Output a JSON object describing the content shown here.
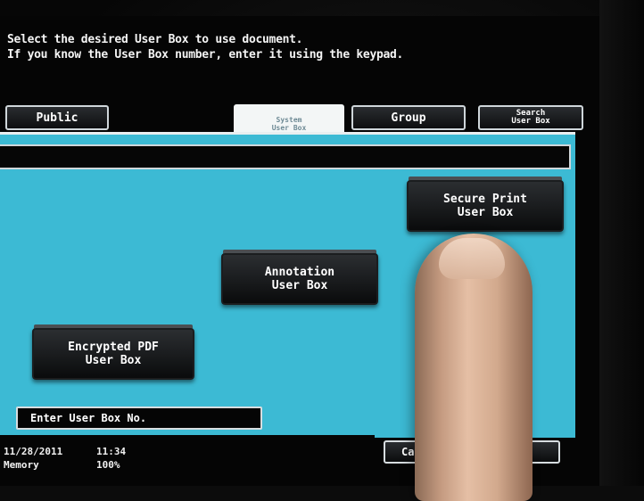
{
  "instructions": {
    "line1": "Select the desired User Box to use document.",
    "line2": "If you know the User Box number, enter it using the keypad."
  },
  "tabs": [
    {
      "label": "Public"
    },
    {
      "label": "System User Box",
      "line1": "System",
      "line2": "User Box",
      "active": true
    },
    {
      "label": "Group"
    },
    {
      "label": "Search User Box",
      "line1": "Search",
      "line2": "User Box"
    }
  ],
  "boxes": [
    {
      "line1": "Secure Print",
      "line2": "User Box"
    },
    {
      "line1": "Annotation",
      "line2": "User Box"
    },
    {
      "line1": "Encrypted PDF",
      "line2": "User Box"
    }
  ],
  "entry_field": {
    "label": "Enter User Box No."
  },
  "status": {
    "date": "11/28/2011",
    "time": "11:34",
    "memory_label": "Memory",
    "memory_value": "100%"
  },
  "cancel_button": {
    "label": "Ca"
  },
  "colors": {
    "panel": "#3cbad4",
    "tile": "#1a1c1e",
    "screen_bg": "#050505"
  }
}
